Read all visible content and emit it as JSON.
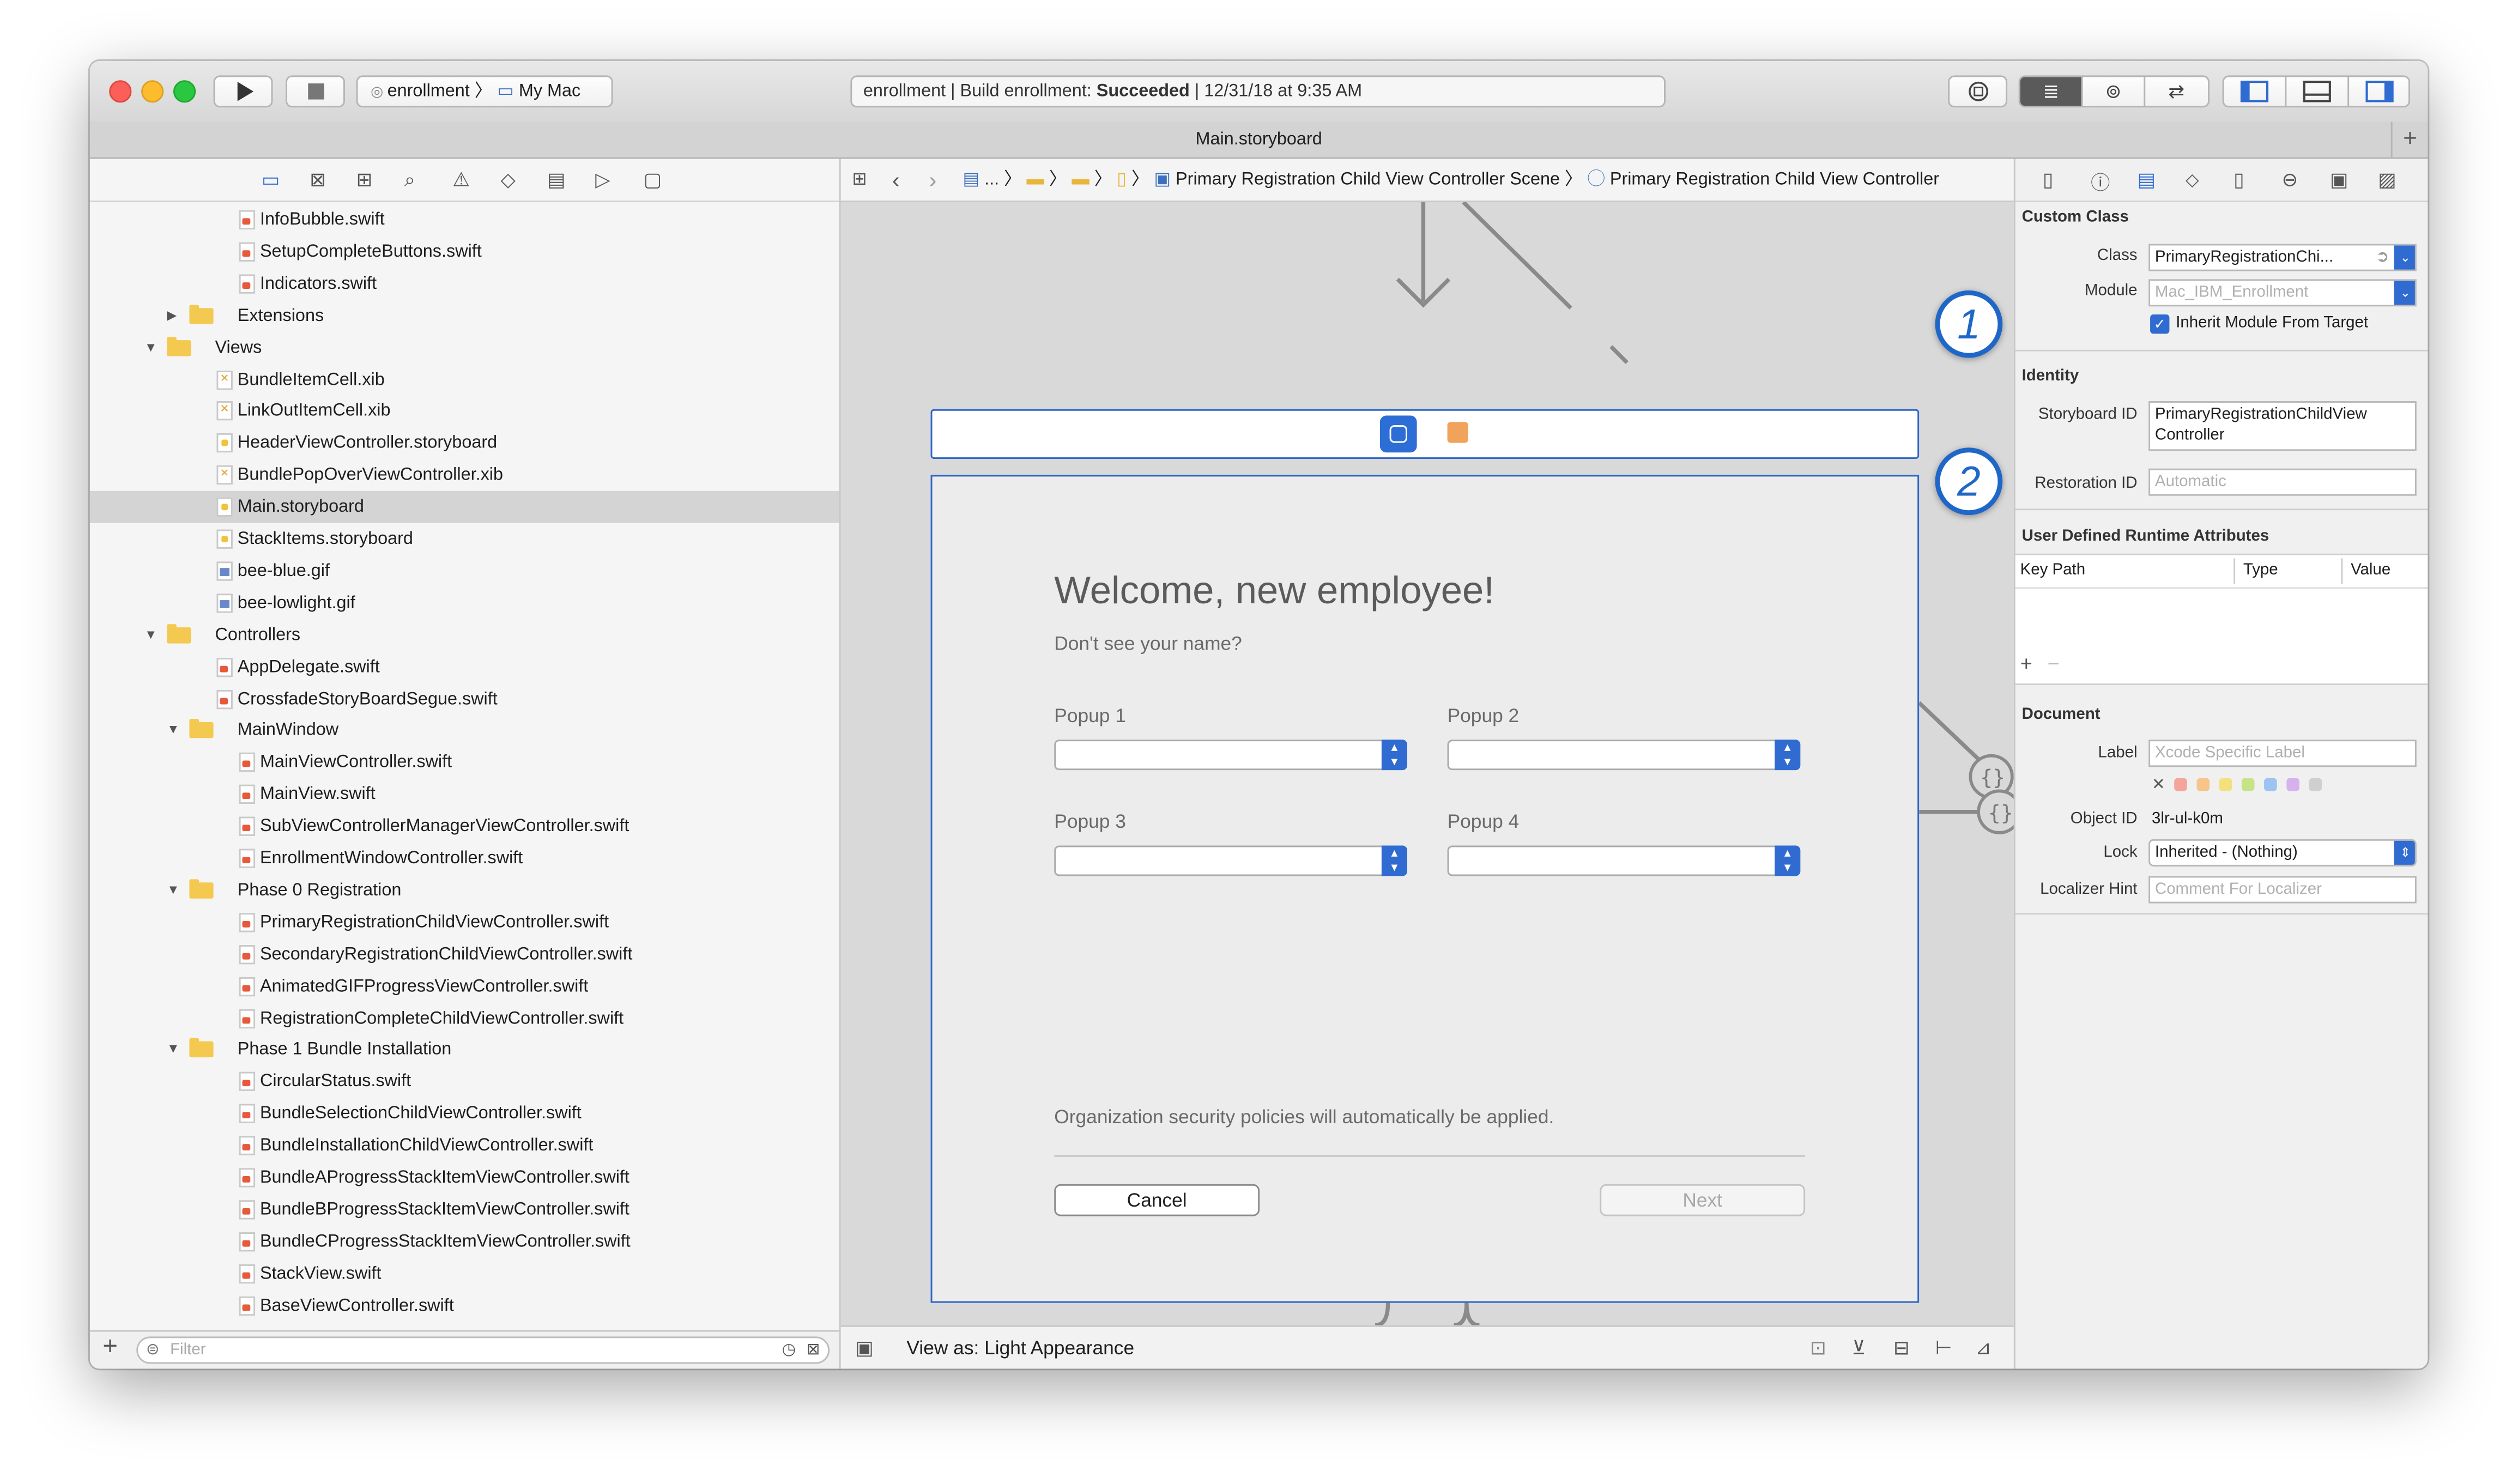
{
  "toolbar": {
    "scheme_target": "enrollment",
    "scheme_destination": "My Mac",
    "activity_prefix": "enrollment | Build enrollment: ",
    "activity_status": "Succeeded",
    "activity_time": " | 12/31/18 at 9:35 AM"
  },
  "tab": {
    "title": "Main.storyboard",
    "add": "+"
  },
  "navigator": {
    "filter_placeholder": "Filter",
    "add": "+",
    "items": [
      {
        "label": "InfoBubble.swift",
        "type": "swift",
        "depth": 2
      },
      {
        "label": "SetupCompleteButtons.swift",
        "type": "swift",
        "depth": 2
      },
      {
        "label": "Indicators.swift",
        "type": "swift",
        "depth": 2
      },
      {
        "label": "Extensions",
        "type": "folder-closed",
        "depth": 1
      },
      {
        "label": "Views",
        "type": "folder-open",
        "depth": 0
      },
      {
        "label": "BundleItemCell.xib",
        "type": "xib",
        "depth": 1
      },
      {
        "label": "LinkOutItemCell.xib",
        "type": "xib",
        "depth": 1
      },
      {
        "label": "HeaderViewController.storyboard",
        "type": "sb",
        "depth": 1
      },
      {
        "label": "BundlePopOverViewController.xib",
        "type": "xib",
        "depth": 1
      },
      {
        "label": "Main.storyboard",
        "type": "sb",
        "depth": 1,
        "selected": true
      },
      {
        "label": "StackItems.storyboard",
        "type": "sb",
        "depth": 1
      },
      {
        "label": "bee-blue.gif",
        "type": "gif",
        "depth": 1
      },
      {
        "label": "bee-lowlight.gif",
        "type": "gif",
        "depth": 1
      },
      {
        "label": "Controllers",
        "type": "folder-open",
        "depth": 0
      },
      {
        "label": "AppDelegate.swift",
        "type": "swift",
        "depth": 1
      },
      {
        "label": "CrossfadeStoryBoardSegue.swift",
        "type": "swift",
        "depth": 1
      },
      {
        "label": "MainWindow",
        "type": "folder-open",
        "depth": 1
      },
      {
        "label": "MainViewController.swift",
        "type": "swift",
        "depth": 2
      },
      {
        "label": "MainView.swift",
        "type": "swift",
        "depth": 2
      },
      {
        "label": "SubViewControllerManagerViewController.swift",
        "type": "swift",
        "depth": 2
      },
      {
        "label": "EnrollmentWindowController.swift",
        "type": "swift",
        "depth": 2
      },
      {
        "label": "Phase 0 Registration",
        "type": "folder-open",
        "depth": 1
      },
      {
        "label": "PrimaryRegistrationChildViewController.swift",
        "type": "swift",
        "depth": 2
      },
      {
        "label": "SecondaryRegistrationChildViewController.swift",
        "type": "swift",
        "depth": 2
      },
      {
        "label": "AnimatedGIFProgressViewController.swift",
        "type": "swift",
        "depth": 2
      },
      {
        "label": "RegistrationCompleteChildViewController.swift",
        "type": "swift",
        "depth": 2
      },
      {
        "label": "Phase 1 Bundle Installation",
        "type": "folder-open",
        "depth": 1
      },
      {
        "label": "CircularStatus.swift",
        "type": "swift",
        "depth": 2
      },
      {
        "label": "BundleSelectionChildViewController.swift",
        "type": "swift",
        "depth": 2
      },
      {
        "label": "BundleInstallationChildViewController.swift",
        "type": "swift",
        "depth": 2
      },
      {
        "label": "BundleAProgressStackItemViewController.swift",
        "type": "swift",
        "depth": 2
      },
      {
        "label": "BundleBProgressStackItemViewController.swift",
        "type": "swift",
        "depth": 2
      },
      {
        "label": "BundleCProgressStackItemViewController.swift",
        "type": "swift",
        "depth": 2
      },
      {
        "label": "StackView.swift",
        "type": "swift",
        "depth": 2
      },
      {
        "label": "BaseViewController.swift",
        "type": "swift",
        "depth": 2
      }
    ]
  },
  "jumpbar": {
    "ellipsis": "...",
    "scene": "Primary Registration Child View Controller Scene",
    "controller": "Primary Registration Child View Controller"
  },
  "canvas": {
    "title": "Welcome, new employee!",
    "subtitle": "Don't see your name?",
    "popups": [
      {
        "label": "Popup 1"
      },
      {
        "label": "Popup 2"
      },
      {
        "label": "Popup 3"
      },
      {
        "label": "Popup 4"
      }
    ],
    "policy": "Organization security policies will automatically be applied.",
    "cancel": "Cancel",
    "next": "Next"
  },
  "editor_footer": {
    "view_as": "View as: Light Appearance"
  },
  "inspector": {
    "custom_class_header": "Custom Class",
    "class_label": "Class",
    "class_value": "PrimaryRegistrationChi...",
    "module_label": "Module",
    "module_placeholder": "Mac_IBM_Enrollment",
    "inherit_label": "Inherit Module From Target",
    "identity_header": "Identity",
    "storyboard_id_label": "Storyboard ID",
    "storyboard_id_value_1": "PrimaryRegistrationChildView",
    "storyboard_id_value_2": "Controller",
    "restoration_id_label": "Restoration ID",
    "restoration_id_placeholder": "Automatic",
    "udra_header": "User Defined Runtime Attributes",
    "col_key_path": "Key Path",
    "col_type": "Type",
    "col_value": "Value",
    "add": "+",
    "remove": "−",
    "document_header": "Document",
    "label_label": "Label",
    "label_placeholder": "Xcode Specific Label",
    "object_id_label": "Object ID",
    "object_id_value": "3lr-ul-k0m",
    "lock_label": "Lock",
    "lock_value": "Inherited - (Nothing)",
    "localizer_label": "Localizer Hint",
    "localizer_placeholder": "Comment For Localizer",
    "badge_1": "1",
    "badge_2": "2"
  },
  "colors": {
    "accent": "#2f6bd1",
    "selection": "#d4d4d4",
    "badge": "#1f66c9"
  }
}
